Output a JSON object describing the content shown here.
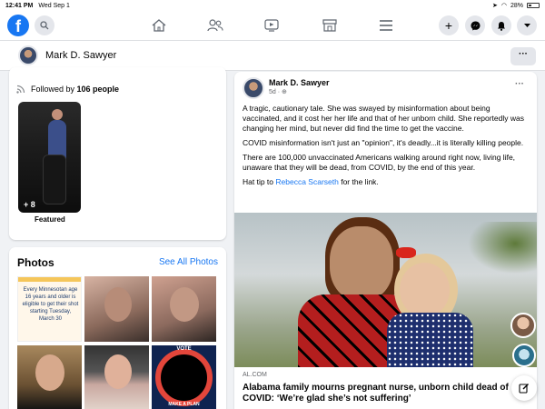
{
  "statusbar": {
    "time": "12:41 PM",
    "date": "Wed Sep 1",
    "battery": "28%"
  },
  "nav": {
    "logo": "f",
    "icons": [
      "home-icon",
      "friends-icon",
      "watch-icon",
      "marketplace-icon",
      "menu-icon"
    ],
    "right_icons": [
      "plus-icon",
      "messenger-icon",
      "notifications-icon",
      "account-menu-icon"
    ]
  },
  "profile": {
    "name": "Mark D. Sawyer",
    "more": "···"
  },
  "featured": {
    "followed_prefix": "Followed by ",
    "followed_count": "106 people",
    "more_count": "+ 8",
    "label": "Featured"
  },
  "photos": {
    "title": "Photos",
    "see_all": "See All Photos",
    "tile1_text": "Every Minnesotan age 16 years and older is eligible to get their shot starting Tuesday, March 30",
    "tile6_text": "VOTE",
    "tile6_bottom": "MAKE A PLAN"
  },
  "post": {
    "author": "Mark D. Sawyer",
    "meta": "5d · ",
    "dots": "···",
    "para1": "A tragic, cautionary tale. She was swayed by misinformation about being vaccinated, and it cost her her life and that of her unborn child.  She reportedly was changing her mind, but never did find the time to get the vaccine.",
    "para2": "COVID misinformation isn't just an \"opinion\", it's deadly...it is literally killing people.",
    "para3": "There are 100,000 unvaccinated Americans walking around right now, living life, unaware that they will be dead, from COVID, by the end of this year.",
    "para4_prefix": "Hat tip to ",
    "para4_link": "Rebecca Scarseth",
    "para4_suffix": " for the link.",
    "link_source": "AL.COM",
    "link_title": "Alabama family mourns pregnant nurse, unborn child dead of COVID: ‘We’re glad she’s not suffering’"
  }
}
